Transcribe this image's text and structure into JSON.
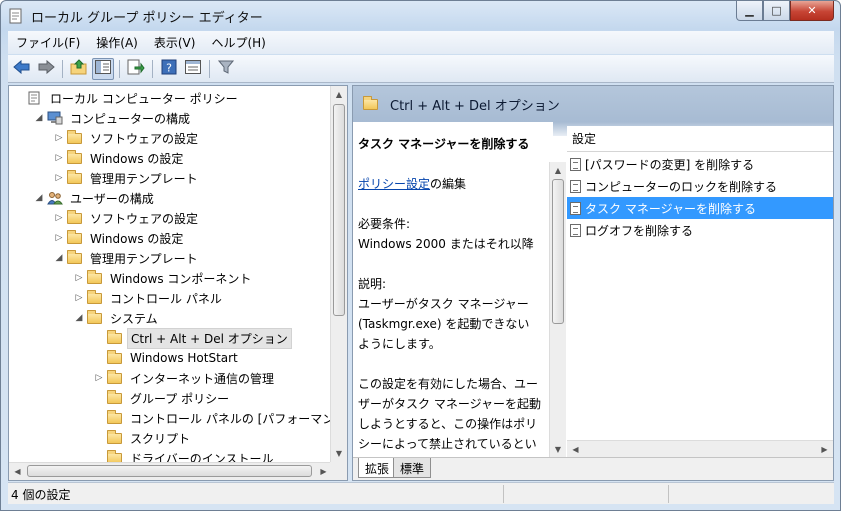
{
  "window": {
    "title": "ローカル グループ ポリシー エディター",
    "min_glyph": "▁",
    "max_glyph": "□",
    "close_glyph": "✕"
  },
  "menu": [
    "ファイル(F)",
    "操作(A)",
    "表示(V)",
    "ヘルプ(H)"
  ],
  "toolbar": {
    "buttons": [
      "back-arrow-icon",
      "forward-arrow-icon",
      "up-folder-icon",
      "show-hide-tree-icon",
      "export-list-icon",
      "help-icon",
      "properties-icon",
      "filter-icon"
    ]
  },
  "tree": [
    {
      "level": 0,
      "expander": "",
      "icon": "policy-document-icon",
      "label": "ローカル コンピューター ポリシー"
    },
    {
      "level": 1,
      "expander": "◢",
      "icon": "computer-icon",
      "label": "コンピューターの構成"
    },
    {
      "level": 2,
      "expander": "▷",
      "icon": "folder-icon",
      "label": "ソフトウェアの設定"
    },
    {
      "level": 2,
      "expander": "▷",
      "icon": "folder-icon",
      "label": "Windows の設定"
    },
    {
      "level": 2,
      "expander": "▷",
      "icon": "folder-icon",
      "label": "管理用テンプレート"
    },
    {
      "level": 1,
      "expander": "◢",
      "icon": "users-icon",
      "label": "ユーザーの構成"
    },
    {
      "level": 2,
      "expander": "▷",
      "icon": "folder-icon",
      "label": "ソフトウェアの設定"
    },
    {
      "level": 2,
      "expander": "▷",
      "icon": "folder-icon",
      "label": "Windows の設定"
    },
    {
      "level": 2,
      "expander": "◢",
      "icon": "folder-icon",
      "label": "管理用テンプレート"
    },
    {
      "level": 3,
      "expander": "▷",
      "icon": "folder-icon",
      "label": "Windows コンポーネント"
    },
    {
      "level": 3,
      "expander": "▷",
      "icon": "folder-icon",
      "label": "コントロール パネル"
    },
    {
      "level": 3,
      "expander": "◢",
      "icon": "folder-icon",
      "label": "システム"
    },
    {
      "level": 4,
      "expander": "",
      "icon": "folder-icon",
      "label": "Ctrl + Alt + Del オプション",
      "selected": true
    },
    {
      "level": 4,
      "expander": "",
      "icon": "folder-icon",
      "label": "Windows HotStart"
    },
    {
      "level": 4,
      "expander": "▷",
      "icon": "folder-icon",
      "label": "インターネット通信の管理"
    },
    {
      "level": 4,
      "expander": "",
      "icon": "folder-icon",
      "label": "グループ ポリシー"
    },
    {
      "level": 4,
      "expander": "",
      "icon": "folder-icon",
      "label": "コントロール パネルの [パフォーマンス"
    },
    {
      "level": 4,
      "expander": "",
      "icon": "folder-icon",
      "label": "スクリプト"
    },
    {
      "level": 4,
      "expander": "",
      "icon": "folder-icon",
      "label": "ドライバーのインストール"
    }
  ],
  "scroll_glyphs": {
    "up": "▲",
    "down": "▼",
    "left": "◀",
    "right": "▶"
  },
  "right": {
    "header_title": "Ctrl + Alt + Del オプション",
    "description": {
      "title": "タスク マネージャーを削除する",
      "link_text": "ポリシー設定",
      "link_suffix": "の編集",
      "req_label": "必要条件:",
      "req_value": "Windows 2000 またはそれ以降",
      "expl_label": "説明:",
      "expl_lines": [
        "ユーザーがタスク マネージャー",
        "(Taskmgr.exe) を起動できない",
        "ようにします。"
      ],
      "detail_lines": [
        "この設定を有効にした場合、ユー",
        "ザーがタスク マネージャーを起動",
        "しようとすると、この操作はポリ",
        "シーによって禁止されているとい"
      ]
    },
    "list_header": "設定",
    "settings": [
      {
        "label": "[パスワードの変更] を削除する"
      },
      {
        "label": "コンピューターのロックを削除する"
      },
      {
        "label": "タスク マネージャーを削除する",
        "selected": true
      },
      {
        "label": "ログオフを削除する"
      }
    ],
    "tabs": [
      "拡張",
      "標準"
    ]
  },
  "status": {
    "text": "4 個の設定"
  },
  "colors": {
    "selection": "#3399ff",
    "header_band": "#b4c6db",
    "link": "#0645ad"
  }
}
